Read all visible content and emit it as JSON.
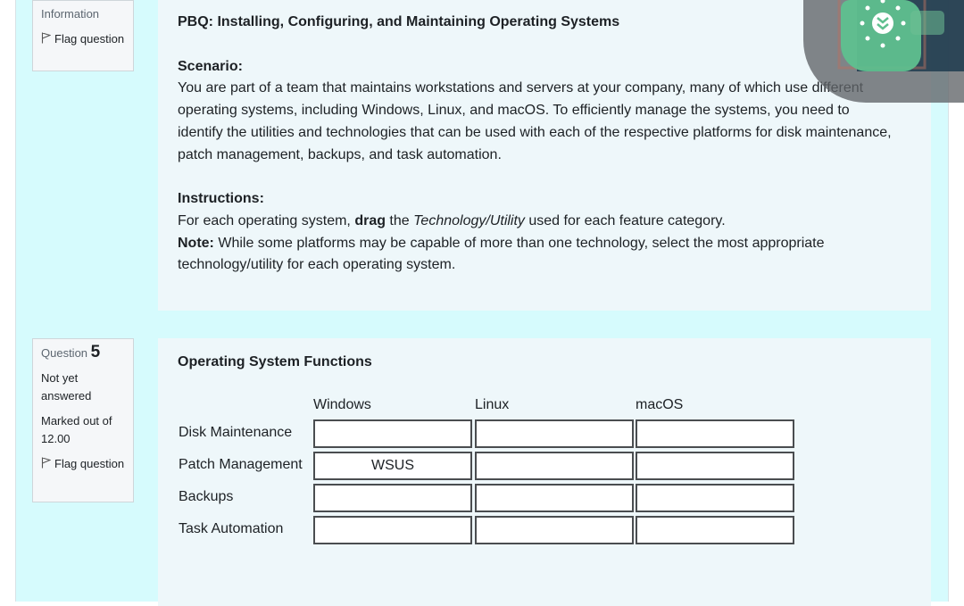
{
  "info_panel_top": {
    "label": "Information",
    "flag_label": "Flag question"
  },
  "intro": {
    "title": "PBQ: Installing, Configuring, and Maintaining Operating Systems",
    "scenario_heading": "Scenario:",
    "scenario_text": "You are part of a team that maintains workstations and servers at your company, many of which use different operating systems, including Windows, Linux, and macOS. To efficiently manage the systems, you need to identify the utilities and technologies that can be used with each of the respective platforms for disk maintenance, patch management, backups, and task automation.",
    "instructions_heading": "Instructions:",
    "instr_part1": "For each operating system, ",
    "instr_bold": "drag",
    "instr_part2": " the ",
    "instr_italic": "Technology/Utility",
    "instr_part3": " used for each feature category.",
    "note_label": "Note:",
    "note_text": " While some platforms may be capable of more than one technology, select the most appropriate technology/utility for each operating system."
  },
  "question_panel": {
    "question_label": "Question",
    "question_number": "5",
    "status": "Not yet answered",
    "marks": "Marked out of 12.00",
    "flag_label": "Flag question"
  },
  "question": {
    "title": "Operating System Functions",
    "columns": [
      "Windows",
      "Linux",
      "macOS"
    ],
    "rows": [
      {
        "label": "Disk Maintenance",
        "cells": [
          "",
          "",
          ""
        ]
      },
      {
        "label": "Patch Management",
        "cells": [
          "WSUS",
          "",
          ""
        ]
      },
      {
        "label": "Backups",
        "cells": [
          "",
          "",
          ""
        ]
      },
      {
        "label": "Task Automation",
        "cells": [
          "",
          "",
          ""
        ]
      }
    ]
  },
  "overlay": {
    "icon": "screen-recorder-icon",
    "colors": {
      "bubble": "#5fc08f",
      "panel": "#1e3b4f"
    }
  }
}
